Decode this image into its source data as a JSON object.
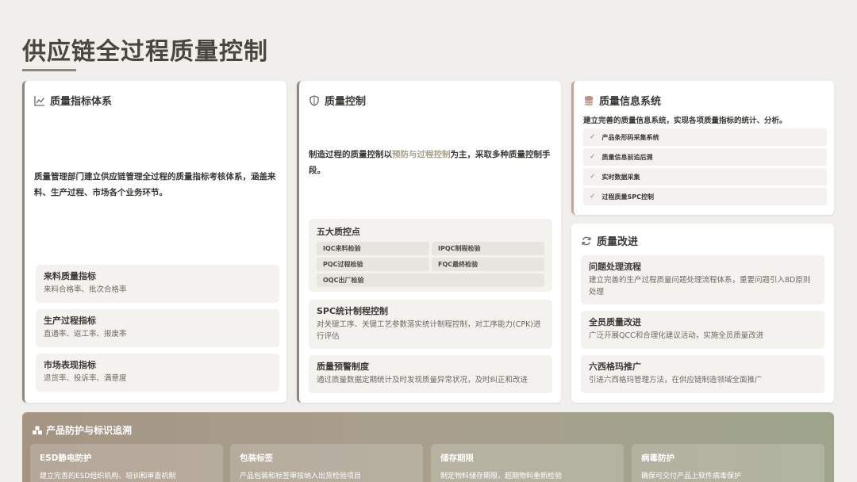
{
  "page": {
    "title": "供应链全过程质量控制"
  },
  "quality_index": {
    "title": "质量指标体系",
    "description": "质量管理部门建立供应链管理全过程的质量指标考核体系，涵盖来料、生产过程、市场各个业务环节。",
    "items": [
      {
        "title": "来料质量指标",
        "text": "来料合格率、批次合格率"
      },
      {
        "title": "生产过程指标",
        "text": "直通率、返工率、报废率"
      },
      {
        "title": "市场表现指标",
        "text": "退货率、投诉率、满意度"
      }
    ]
  },
  "quality_control": {
    "title": "质量控制",
    "desc_before": "制造过程的质量控制以",
    "desc_highlight": "预防与过程控制",
    "desc_after": "为主，采取多种质量控制手段。",
    "five_points": {
      "title": "五大质控点",
      "items": [
        "IQC来料检验",
        "IPQC制程检验",
        "PQC过程检验",
        "FQC最终检验",
        "OQC出厂检验"
      ]
    },
    "spc": {
      "title": "SPC统计制程控制",
      "text": "对关键工序、关键工艺参数落实统计制程控制，对工序能力(CPK)进行评估"
    },
    "warning": {
      "title": "质量预警制度",
      "text": "通过质量数据定期统计及时发现质量异常状况，及时纠正和改进"
    }
  },
  "info_system": {
    "title": "质量信息系统",
    "description": "建立完善的质量信息系统，实现各项质量指标的统计、分析。",
    "items": [
      "产品条形码采集系统",
      "质量信息前追后溯",
      "实时数据采集",
      "过程质量SPC控制"
    ]
  },
  "improvement": {
    "title": "质量改进",
    "items": [
      {
        "title": "问题处理流程",
        "text": "建立完善的生产过程质量问题处理流程体系，重要问题引入8D原则处理"
      },
      {
        "title": "全员质量改进",
        "text": "广泛开展QCC和合理化建议活动，实施全员质量改进"
      },
      {
        "title": "六西格玛推广",
        "text": "引进六西格玛管理方法，在供应链制造领域全面推广"
      }
    ]
  },
  "protection": {
    "title": "产品防护与标识追溯",
    "items": [
      {
        "title": "ESD静电防护",
        "text": "建立完善的ESD组织机构、培训和审查机制"
      },
      {
        "title": "包装标签",
        "text": "产品包装和标签审核纳入出货检验项目"
      },
      {
        "title": "储存期限",
        "text": "制定物料储存期限，超期物料重新检验"
      },
      {
        "title": "病毒防护",
        "text": "确保可交付产品上软件病毒保护"
      }
    ]
  },
  "icons": {
    "chart": "line-chart-icon",
    "shield": "shield-icon",
    "database": "database-icon",
    "refresh": "refresh-icon",
    "boxes": "boxes-icon",
    "check": "check-icon"
  },
  "colors": {
    "background": "#f1efec",
    "accent_gray": "#8c8780",
    "accent_rose": "#c4a79c",
    "highlight": "#a7a08f",
    "bottom_gradient_start": "#a59483",
    "bottom_gradient_end": "#9ea48c"
  }
}
